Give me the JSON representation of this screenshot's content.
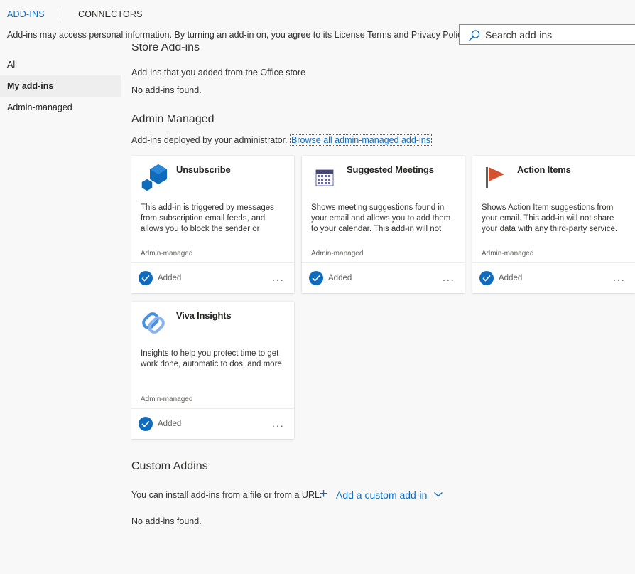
{
  "tabs": [
    {
      "label": "ADD-INS",
      "active": true
    },
    {
      "label": "CONNECTORS",
      "active": false
    }
  ],
  "privacy_notice": "Add-ins may access personal information. By turning an add-in on, you agree to its License Terms and Privacy Policy.",
  "search": {
    "placeholder": "Search add-ins",
    "value": "",
    "icon": "search-icon"
  },
  "nav": {
    "items": [
      {
        "label": "All",
        "active": false
      },
      {
        "label": "My add-ins",
        "active": true
      },
      {
        "label": "Admin-managed",
        "active": false
      }
    ]
  },
  "sections": {
    "store": {
      "title": "Store Add-ins",
      "description": "Add-ins that you added from the Office store",
      "empty": "No add-ins found."
    },
    "admin": {
      "title": "Admin Managed",
      "description": "Add-ins deployed by your administrator.",
      "link": "Browse all admin-managed add-ins"
    },
    "custom": {
      "title": "Custom Addins",
      "description": "You can install add-ins from a file or from a URL.",
      "add_label": "Add a custom add-in",
      "empty": "No add-ins found."
    }
  },
  "cards": [
    {
      "title": "Unsubscribe",
      "icon": "unsubscribe-hexagon-icon",
      "description": "This add-in is triggered by messages from subscription email feeds, and allows you to block the sender or",
      "meta": "Admin-managed",
      "status": "Added",
      "more": "..."
    },
    {
      "title": "Suggested Meetings",
      "icon": "calendar-icon",
      "description": "Shows meeting suggestions found in your email and allows you to add them to your calendar. This add-in will not",
      "meta": "Admin-managed",
      "status": "Added",
      "more": "..."
    },
    {
      "title": "Action Items",
      "icon": "flag-icon",
      "description": "Shows Action Item suggestions from your email. This add-in will not share your data with any third-party service.",
      "meta": "Admin-managed",
      "status": "Added",
      "more": "..."
    },
    {
      "title": "Viva Insights",
      "icon": "viva-insights-icon",
      "description": "Insights to help you protect time to get work done, automatic to dos, and more.",
      "meta": "Admin-managed",
      "status": "Added",
      "more": "..."
    }
  ],
  "colors": {
    "accent": "#0f6cbd",
    "background": "#f8f8f8",
    "card": "#ffffff",
    "flag": "#d35230",
    "viva": "#4a90e2"
  }
}
